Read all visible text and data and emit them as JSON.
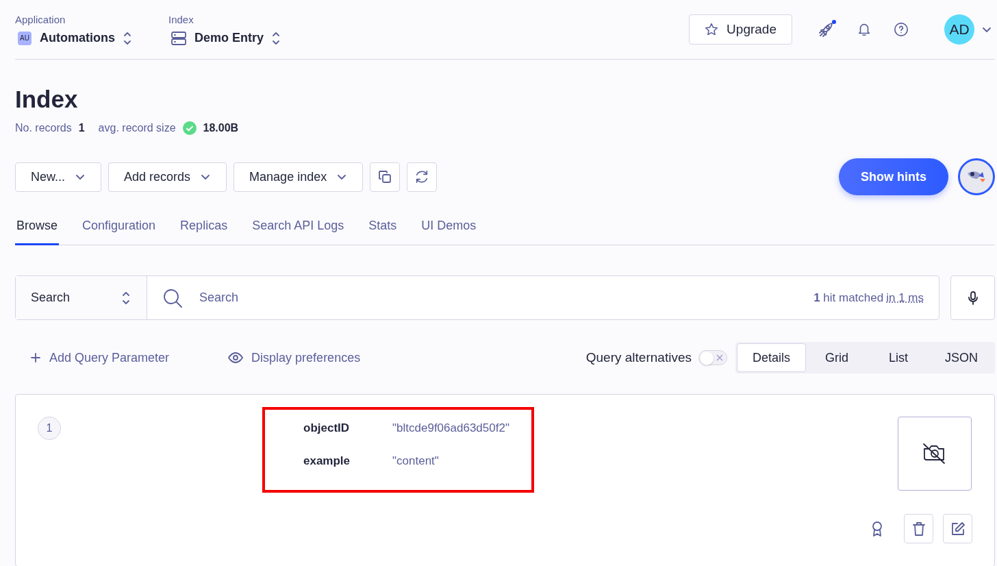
{
  "header": {
    "app_selector": {
      "label": "Application",
      "badge": "AU",
      "value": "Automations"
    },
    "index_selector": {
      "label": "Index",
      "value": "Demo Entry"
    },
    "upgrade_button": "Upgrade",
    "news_dot": true,
    "avatar": "AD"
  },
  "page": {
    "title": "Index",
    "stats": [
      {
        "label": "No. records",
        "value": "1",
        "verified": false
      },
      {
        "label": "avg. record size",
        "value": "18.00B",
        "verified": true
      }
    ]
  },
  "toolbar": {
    "buttons": [
      {
        "kind": "dropdown",
        "label": "New..."
      },
      {
        "kind": "dropdown",
        "label": "Add records"
      },
      {
        "kind": "dropdown",
        "label": "Manage index"
      },
      {
        "kind": "copy"
      },
      {
        "kind": "refresh"
      }
    ],
    "hints_button": "Show hints"
  },
  "tabs": [
    {
      "label": "Browse",
      "selected": true
    },
    {
      "label": "Configuration",
      "selected": false
    },
    {
      "label": "Replicas",
      "selected": false
    },
    {
      "label": "Search API Logs",
      "selected": false
    },
    {
      "label": "Stats",
      "selected": false
    },
    {
      "label": "UI Demos",
      "selected": false
    }
  ],
  "search": {
    "mode": "Search",
    "placeholder": "Search",
    "hits_count": "1",
    "hits_text": "hit matched",
    "time": "in 1 ms"
  },
  "options": {
    "add_parameter": "Add Query Parameter",
    "display_preferences": "Display preferences",
    "query_alternatives": {
      "label": "Query alternatives",
      "on": false
    },
    "views": [
      {
        "label": "Details",
        "selected": true
      },
      {
        "label": "Grid",
        "selected": false
      },
      {
        "label": "List",
        "selected": false
      },
      {
        "label": "JSON",
        "selected": false
      }
    ]
  },
  "records": [
    {
      "number": "1",
      "highlighted": true,
      "fields": [
        {
          "key": "objectID",
          "value": "\"bltcde9f06ad63d50f2\""
        },
        {
          "key": "example",
          "value": "\"content\""
        }
      ]
    }
  ]
}
